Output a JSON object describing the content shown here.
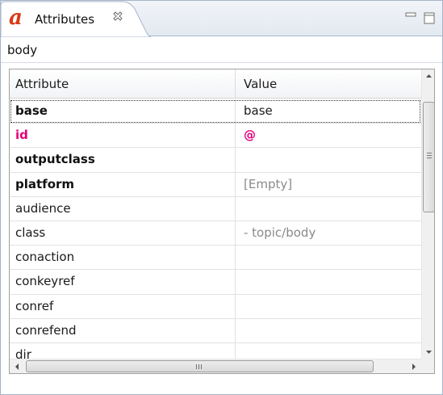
{
  "tab": {
    "icon_glyph": "a",
    "icon_name": "attributes-view-icon",
    "title": "Attributes",
    "close_glyph": "close-icon"
  },
  "breadcrumb": "body",
  "columns": {
    "attribute": "Attribute",
    "value": "Value"
  },
  "rows": [
    {
      "name": "base",
      "value": "base",
      "style": "bold",
      "value_style": "normal",
      "focused": true
    },
    {
      "name": "id",
      "value": "@",
      "style": "pink",
      "value_style": "pink",
      "focused": false
    },
    {
      "name": "outputclass",
      "value": "",
      "style": "bold",
      "value_style": "normal",
      "focused": false
    },
    {
      "name": "platform",
      "value": "[Empty]",
      "style": "bold",
      "value_style": "grey",
      "focused": false
    },
    {
      "name": "audience",
      "value": "",
      "style": "normal",
      "value_style": "normal",
      "focused": false
    },
    {
      "name": "class",
      "value": "- topic/body",
      "style": "normal",
      "value_style": "grey",
      "focused": false
    },
    {
      "name": "conaction",
      "value": "",
      "style": "normal",
      "value_style": "normal",
      "focused": false
    },
    {
      "name": "conkeyref",
      "value": "",
      "style": "normal",
      "value_style": "normal",
      "focused": false
    },
    {
      "name": "conref",
      "value": "",
      "style": "normal",
      "value_style": "normal",
      "focused": false
    },
    {
      "name": "conrefend",
      "value": "",
      "style": "normal",
      "value_style": "normal",
      "focused": false
    },
    {
      "name": "dir",
      "value": "",
      "style": "normal",
      "value_style": "normal",
      "focused": false
    }
  ],
  "colors": {
    "icon_red": "#d93a16",
    "id_pink": "#e5007a",
    "empty_grey": "#8a8a8a"
  }
}
